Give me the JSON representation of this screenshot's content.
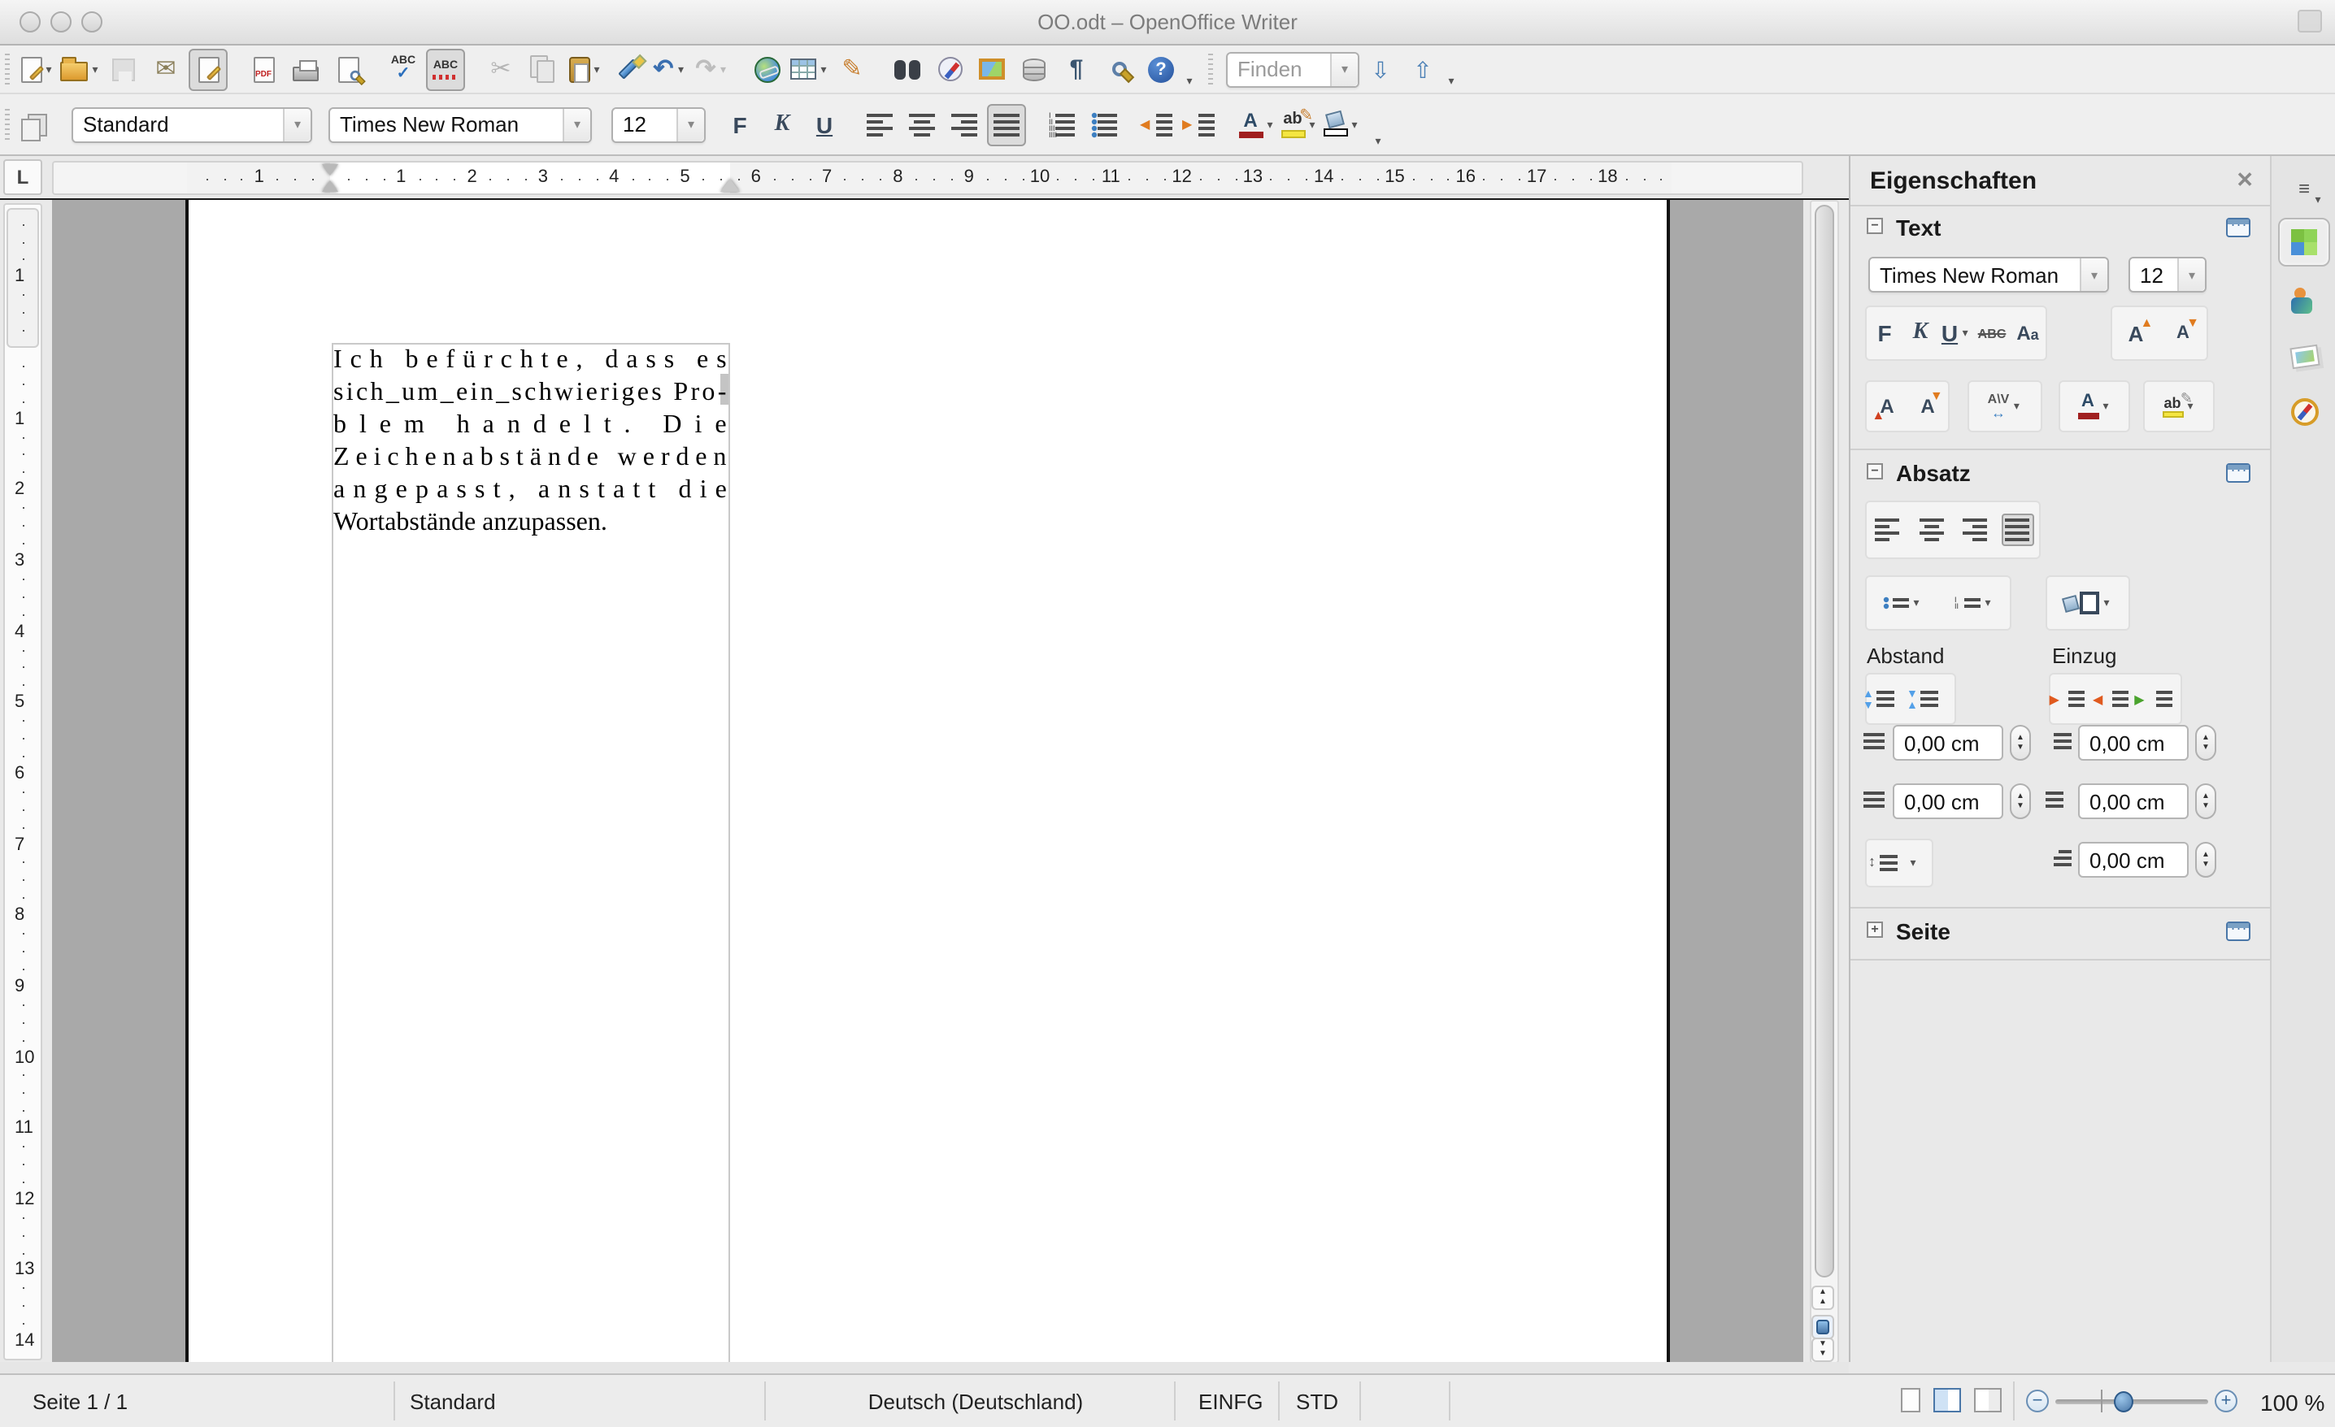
{
  "window": {
    "title": "OO.odt – OpenOffice Writer"
  },
  "glyphs": {
    "dropdown": "▾",
    "corner_tab": "L",
    "close": "✕",
    "menu": "≡",
    "envelope": "✉",
    "scissors": "✂",
    "undo": "↶",
    "redo": "↷",
    "pilcrow": "¶",
    "help": "?",
    "draw_pencil": "✎",
    "abc": "ABC",
    "check": "✓",
    "bold": "F",
    "italic": "K",
    "underline": "U",
    "strike": "ABC",
    "font_a": "A",
    "highlight_ab": "ab",
    "search_down": "⇩",
    "search_up": "⇧",
    "minus": "−",
    "plus": "+",
    "spin_up": "▲",
    "spin_down": "▼",
    "collapse": "−",
    "expand": "+",
    "pdf_label": "PDF"
  },
  "standard_toolbar": {
    "find_placeholder": "Finden",
    "icons": [
      "new-document",
      "open",
      "save",
      "mail",
      "edit-file",
      "export-pdf",
      "print",
      "page-preview",
      "spelling",
      "auto-spellcheck",
      "cut",
      "copy",
      "paste",
      "format-paintbrush",
      "undo",
      "redo",
      "hyperlink",
      "table",
      "draw-functions",
      "find-replace",
      "navigator",
      "gallery",
      "data-sources",
      "formatting-marks",
      "zoom",
      "help"
    ]
  },
  "formatting_toolbar": {
    "paragraph_style": "Standard",
    "font_name": "Times New Roman",
    "font_size": "12"
  },
  "ruler": {
    "h_margin_number": "1",
    "h_numbers": [
      "1",
      "2",
      "3",
      "4",
      "5",
      "6",
      "7",
      "8",
      "9",
      "10",
      "11",
      "12",
      "13",
      "14",
      "15",
      "16",
      "17",
      "18"
    ],
    "v_margin_number": "1",
    "v_numbers": [
      "1",
      "2",
      "3",
      "4",
      "5",
      "6",
      "7",
      "8",
      "9",
      "10",
      "11",
      "12",
      "13",
      "14"
    ]
  },
  "document": {
    "lines": [
      {
        "text": "Ich befürchte, dass es",
        "justify": true
      },
      {
        "text": "sich_um_ein_schwieriges Pro-",
        "justify": true
      },
      {
        "text": "blem handelt. Die",
        "justify": true
      },
      {
        "text": "Zeichenabstände werden",
        "justify": true
      },
      {
        "text": "angepasst, anstatt die",
        "justify": true
      },
      {
        "text": "Wortabstände anzupassen.",
        "justify": false
      }
    ]
  },
  "sidebar": {
    "title": "Eigenschaften",
    "text_section": {
      "label": "Text",
      "font_name": "Times New Roman",
      "font_size": "12"
    },
    "paragraph_section": {
      "label": "Absatz",
      "spacing_label": "Abstand",
      "indent_label": "Einzug",
      "fields": {
        "above_paragraph": "0,00 cm",
        "below_paragraph": "0,00 cm",
        "before_text": "0,00 cm",
        "after_text": "0,00 cm",
        "first_line": "0,00 cm"
      }
    },
    "page_section": {
      "label": "Seite"
    }
  },
  "statusbar": {
    "page": "Seite 1 / 1",
    "page_style": "Standard",
    "language": "Deutsch (Deutschland)",
    "insert_mode": "EINFG",
    "selection_mode": "STD",
    "zoom_level": "100 %"
  }
}
